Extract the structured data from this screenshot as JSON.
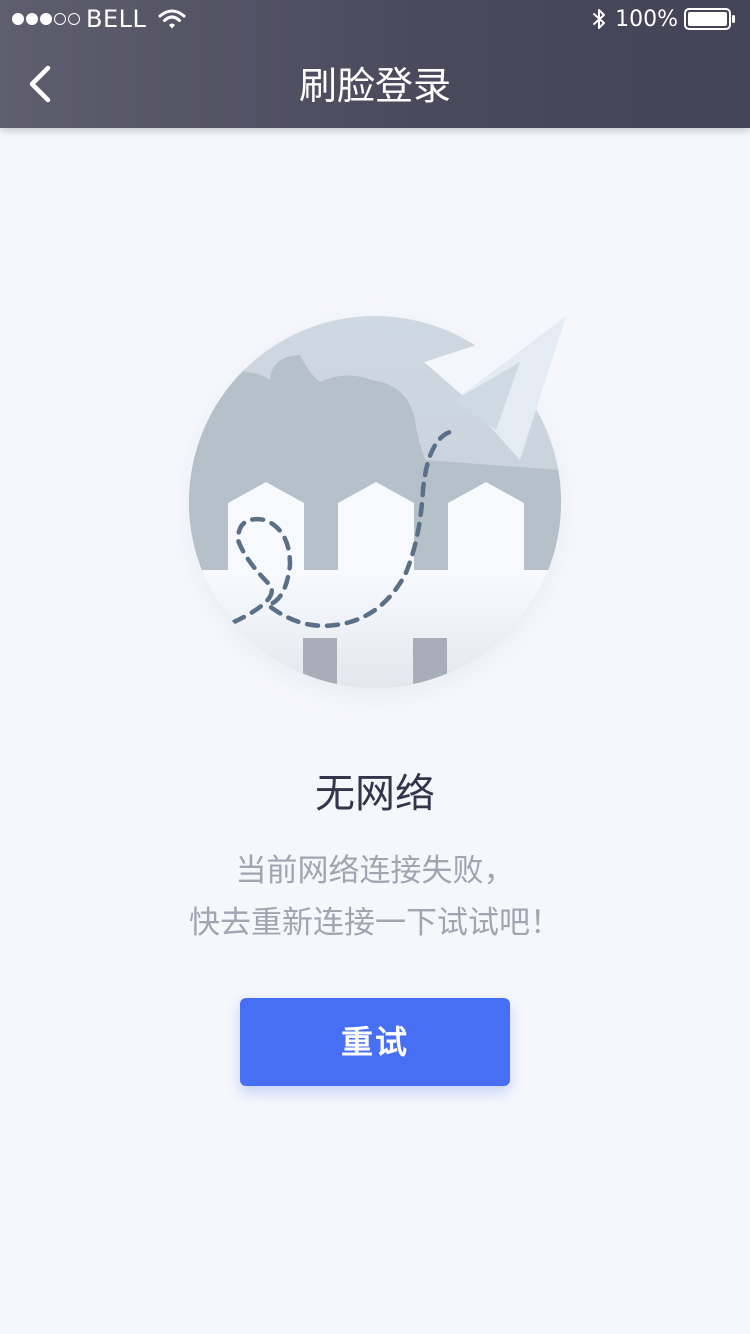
{
  "status_bar": {
    "carrier": "BELL",
    "signal_bars_filled": 3,
    "signal_bars_total": 5,
    "battery_percent": "100%",
    "wifi_icon": "wifi-icon",
    "bluetooth_icon": "bluetooth-icon",
    "battery_icon": "battery-icon"
  },
  "nav": {
    "back_icon": "chevron-left-icon",
    "title": "刷脸登录"
  },
  "illustration": {
    "icon": "no-network-illustration"
  },
  "message": {
    "title": "无网络",
    "lines": [
      "当前网络连接失败，",
      "快去重新连接一下试试吧！"
    ]
  },
  "retry_button": {
    "label": "重试"
  },
  "colors": {
    "header_start": "#5f5e6e",
    "header_end": "#444356",
    "background": "#f6f7fb",
    "primary": "#466ff4",
    "title_text": "#33364a",
    "body_text": "#a1a4b1"
  }
}
